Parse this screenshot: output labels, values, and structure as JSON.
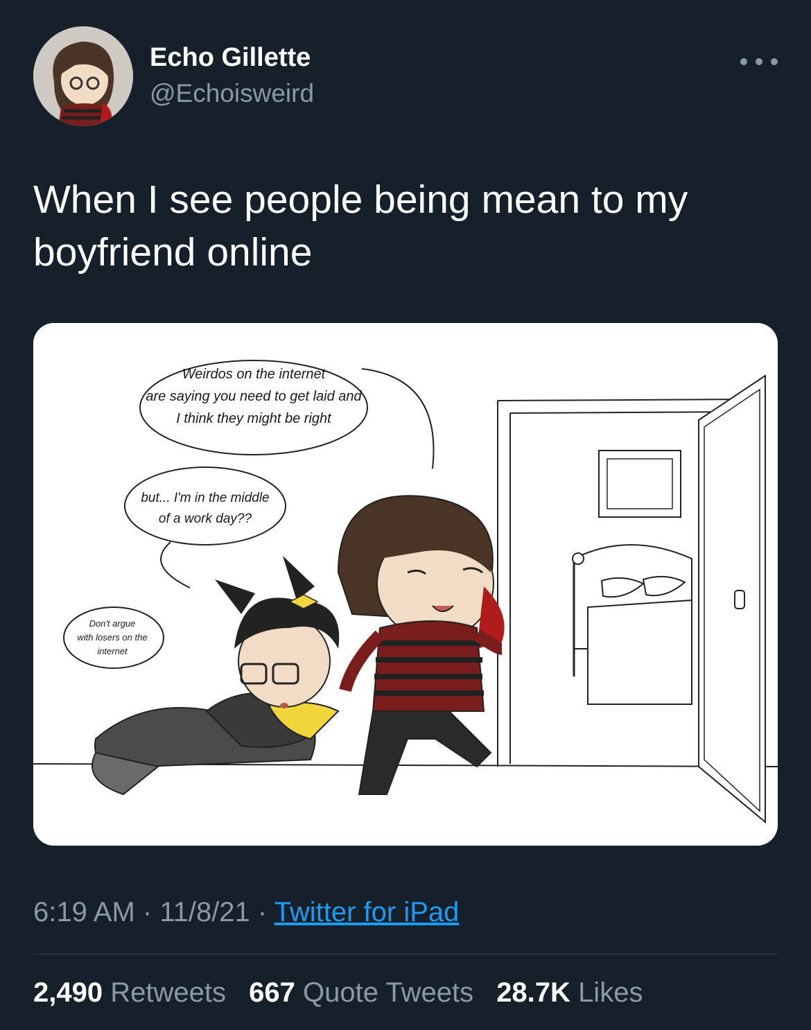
{
  "author": {
    "display_name": "Echo Gillette",
    "handle": "@Echoisweird"
  },
  "tweet": {
    "text": "When I see people being mean to my boyfriend online"
  },
  "image": {
    "bubble_1": [
      "Weirdos on the internet",
      "are saying you need to get laid and",
      "I think they might be right"
    ],
    "bubble_2": [
      "but... I'm in the middle",
      "of a work day??"
    ],
    "bubble_3": [
      "Don't argue",
      "with losers on the",
      "internet"
    ]
  },
  "meta": {
    "time": "6:19 AM",
    "sep1": " · ",
    "date": "11/8/21",
    "sep2": " · ",
    "source": "Twitter for iPad"
  },
  "stats": {
    "retweets_count": "2,490",
    "retweets_label": "Retweets",
    "quotes_count": "667",
    "quotes_label": "Quote Tweets",
    "likes_count": "28.7K",
    "likes_label": "Likes"
  },
  "colors": {
    "background": "#15202b",
    "secondary_text": "#8b98a5",
    "link": "#1d9bf0"
  }
}
